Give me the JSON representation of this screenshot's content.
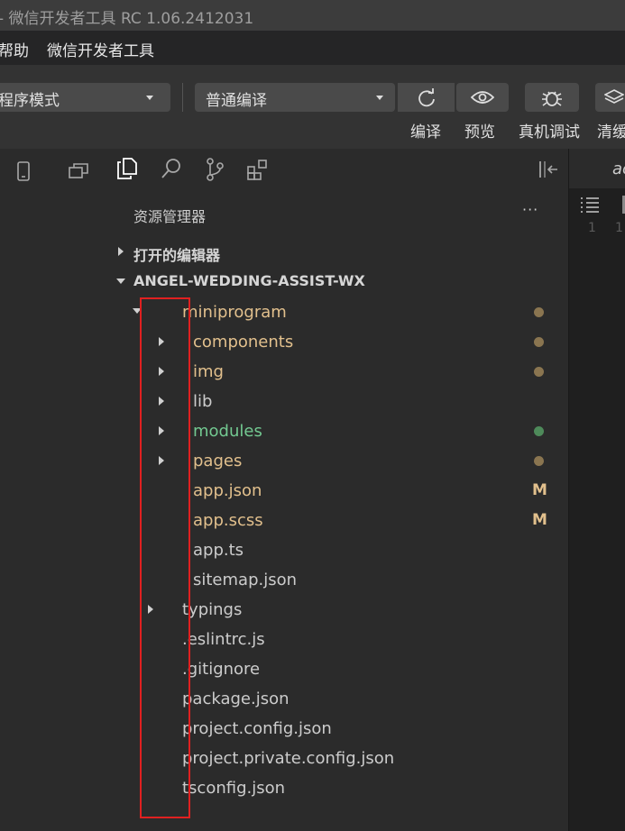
{
  "window": {
    "title": "- 微信开发者工具 RC 1.06.2412031"
  },
  "menu": {
    "items": [
      "帮助",
      "微信开发者工具"
    ]
  },
  "toolbar": {
    "mode_select": "程序模式",
    "compile_select": "普通编译",
    "labels": {
      "compile": "编译",
      "preview": "预览",
      "remote_debug": "真机调试",
      "clear_cache": "清缓"
    }
  },
  "explorer": {
    "title": "资源管理器",
    "more": "···",
    "open_editors": "打开的编辑器",
    "project": "ANGEL-WEDDING-ASSIST-WX",
    "tree": [
      {
        "name": "miniprogram",
        "kind": "folder-open",
        "depth": 1,
        "color": "#e2c08d",
        "status": "dot",
        "status_color": "#8a7550"
      },
      {
        "name": "components",
        "kind": "folder",
        "depth": 2,
        "color": "#e2c08d",
        "status": "dot",
        "status_color": "#8a7550"
      },
      {
        "name": "img",
        "kind": "folder",
        "depth": 2,
        "color": "#e2c08d",
        "status": "dot",
        "status_color": "#8a7550"
      },
      {
        "name": "lib",
        "kind": "folder",
        "depth": 2,
        "color": "#cccccc",
        "status": "",
        "status_color": ""
      },
      {
        "name": "modules",
        "kind": "folder",
        "depth": 2,
        "color": "#73c991",
        "status": "dot",
        "status_color": "#4e8a5a"
      },
      {
        "name": "pages",
        "kind": "folder",
        "depth": 2,
        "color": "#e2c08d",
        "status": "dot",
        "status_color": "#8a7550"
      },
      {
        "name": "app.json",
        "kind": "file",
        "depth": 2,
        "color": "#e2c08d",
        "status": "M",
        "status_color": "#e2c08d"
      },
      {
        "name": "app.scss",
        "kind": "file",
        "depth": 2,
        "color": "#e2c08d",
        "status": "M",
        "status_color": "#e2c08d"
      },
      {
        "name": "app.ts",
        "kind": "file",
        "depth": 2,
        "color": "#cccccc",
        "status": "",
        "status_color": ""
      },
      {
        "name": "sitemap.json",
        "kind": "file",
        "depth": 2,
        "color": "#cccccc",
        "status": "",
        "status_color": ""
      },
      {
        "name": "typings",
        "kind": "folder",
        "depth": 1,
        "color": "#cccccc",
        "status": "",
        "status_color": ""
      },
      {
        "name": ".eslintrc.js",
        "kind": "file",
        "depth": 1,
        "color": "#cccccc",
        "status": "",
        "status_color": ""
      },
      {
        "name": ".gitignore",
        "kind": "file",
        "depth": 1,
        "color": "#cccccc",
        "status": "",
        "status_color": ""
      },
      {
        "name": "package.json",
        "kind": "file",
        "depth": 1,
        "color": "#cccccc",
        "status": "",
        "status_color": ""
      },
      {
        "name": "project.config.json",
        "kind": "file",
        "depth": 1,
        "color": "#cccccc",
        "status": "",
        "status_color": ""
      },
      {
        "name": "project.private.config.json",
        "kind": "file",
        "depth": 1,
        "color": "#cccccc",
        "status": "",
        "status_color": ""
      },
      {
        "name": "tsconfig.json",
        "kind": "file",
        "depth": 1,
        "color": "#cccccc",
        "status": "",
        "status_color": ""
      }
    ]
  },
  "editor": {
    "tab_partial": "ac",
    "line_numbers": [
      "1",
      "1"
    ]
  },
  "icons": [
    "phone-icon",
    "multi-window-icon",
    "files-icon",
    "search-icon",
    "source-control-icon",
    "extensions-icon",
    "collapse-panel-icon",
    "refresh-icon",
    "eye-icon",
    "bug-icon",
    "layers-icon",
    "list-icon"
  ]
}
